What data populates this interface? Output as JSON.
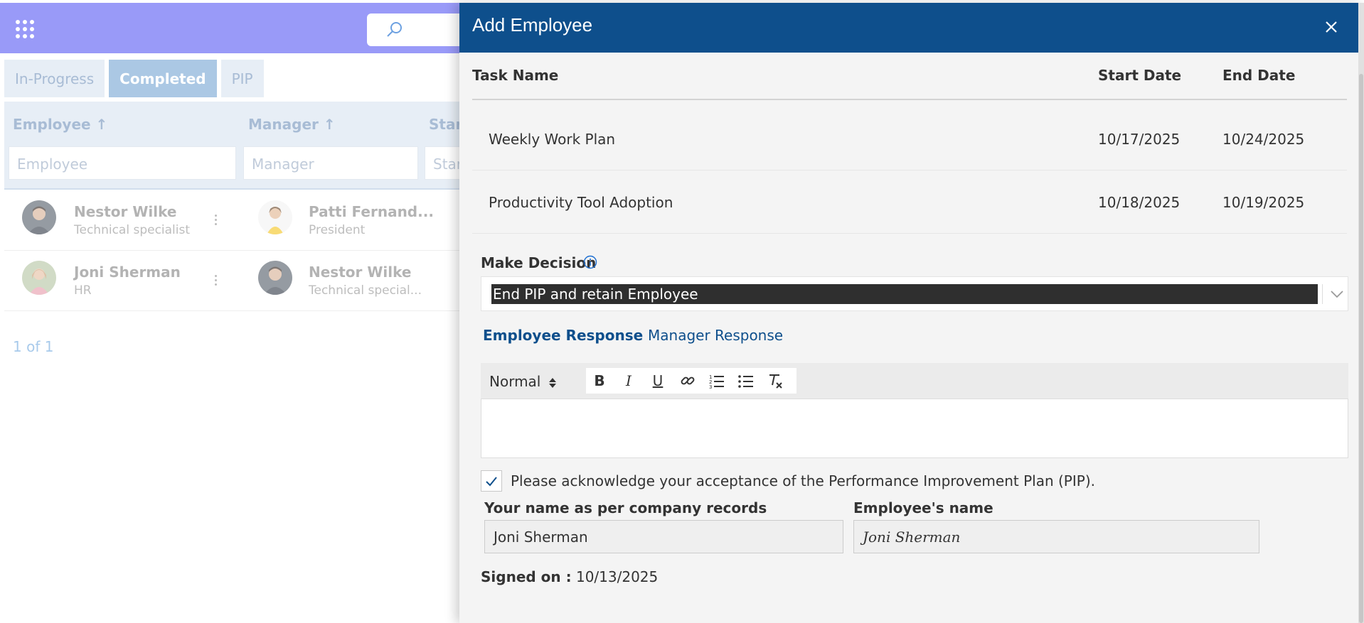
{
  "app": {
    "tabs": [
      {
        "label": "In-Progress",
        "active": false
      },
      {
        "label": "Completed",
        "active": true
      },
      {
        "label": "PIP",
        "active": false
      }
    ],
    "columns": {
      "employee": "Employee ↑",
      "manager": "Manager ↑",
      "start": "Start"
    },
    "filters": {
      "employee_placeholder": "Employee",
      "manager_placeholder": "Manager",
      "start_placeholder": "Star"
    },
    "rows": [
      {
        "employee": "Nestor Wilke",
        "employee_role": "Technical specialist",
        "manager": "Patti Fernand...",
        "manager_role": "President"
      },
      {
        "employee": "Joni Sherman",
        "employee_role": "HR",
        "manager": "Nestor Wilke",
        "manager_role": "Technical special..."
      }
    ],
    "pager": "1 of 1"
  },
  "panel": {
    "title": "Add Employee",
    "table": {
      "headers": {
        "task": "Task Name",
        "start": "Start Date",
        "end": "End Date"
      },
      "rows": [
        {
          "task": "Weekly Work Plan",
          "start": "10/17/2025",
          "end": "10/24/2025"
        },
        {
          "task": "Productivity Tool Adoption",
          "start": "10/18/2025",
          "end": "10/19/2025"
        }
      ]
    },
    "decision": {
      "label": "Make Decision",
      "value": "End PIP and retain Employee"
    },
    "response_tabs": {
      "employee": "Employee Response",
      "manager": "Manager Response"
    },
    "editor": {
      "format": "Normal"
    },
    "acknowledge": {
      "checked": true,
      "text": "Please acknowledge your acceptance of the Performance Improvement Plan (PIP)."
    },
    "fields": {
      "name_label": "Your name as per company records",
      "name_value": "Joni Sherman",
      "employee_label": "Employee's name",
      "employee_signature": "Joni Sherman"
    },
    "signed": {
      "label": "Signed on :",
      "value": "10/13/2025"
    }
  },
  "colors": {
    "topbar": "#6364f5",
    "panel_header": "#0e4f8c",
    "accent_link": "#0e4f8c"
  }
}
